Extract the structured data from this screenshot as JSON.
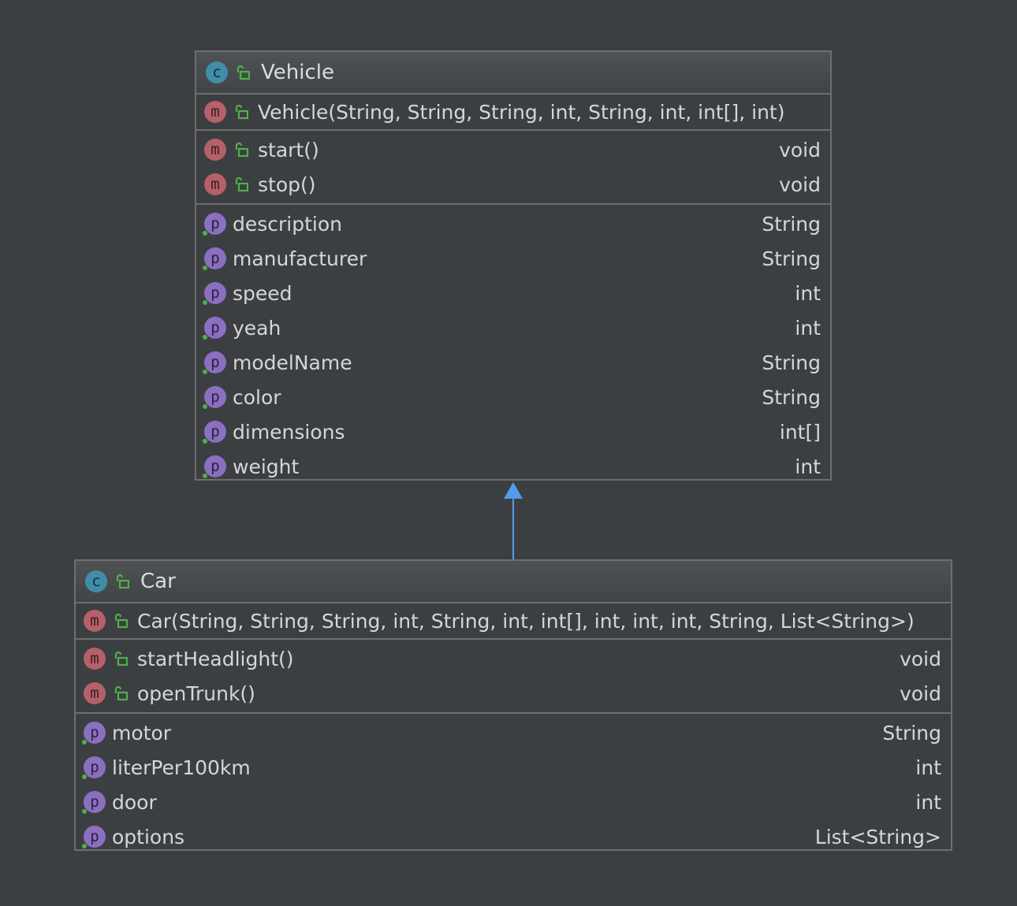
{
  "classes": {
    "vehicle": {
      "kind_badge": "c",
      "name": "Vehicle",
      "constructor": "Vehicle(String, String, String, int, String, int, int[], int)",
      "methods": [
        {
          "name": "start()",
          "type": "void"
        },
        {
          "name": "stop()",
          "type": "void"
        }
      ],
      "fields": [
        {
          "name": "description",
          "type": "String"
        },
        {
          "name": "manufacturer",
          "type": "String"
        },
        {
          "name": "speed",
          "type": "int"
        },
        {
          "name": "yeah",
          "type": "int"
        },
        {
          "name": "modelName",
          "type": "String"
        },
        {
          "name": "color",
          "type": "String"
        },
        {
          "name": "dimensions",
          "type": "int[]"
        },
        {
          "name": "weight",
          "type": "int"
        }
      ]
    },
    "car": {
      "kind_badge": "c",
      "name": "Car",
      "constructor": "Car(String, String, String, int, String, int, int[], int, int, int, String, List<String>)",
      "methods": [
        {
          "name": "startHeadlight()",
          "type": "void"
        },
        {
          "name": "openTrunk()",
          "type": "void"
        }
      ],
      "fields": [
        {
          "name": "motor",
          "type": "String"
        },
        {
          "name": "literPer100km",
          "type": "int"
        },
        {
          "name": "door",
          "type": "int"
        },
        {
          "name": "options",
          "type": "List<String>"
        }
      ]
    }
  },
  "badges": {
    "method": "m",
    "property": "p"
  },
  "icons": {
    "class": "class-icon",
    "method": "method-icon",
    "property": "property-icon",
    "visibility": "unlocked-icon",
    "inheritance": "inheritance-arrow"
  },
  "colors": {
    "background": "#3c3f41",
    "border": "#6e6e6e",
    "class_badge": "#3f8ea8",
    "method_badge": "#b5606a",
    "property_badge": "#8b6fc0",
    "visibility_icon": "#4fb04a",
    "arrow": "#4f9de8"
  }
}
